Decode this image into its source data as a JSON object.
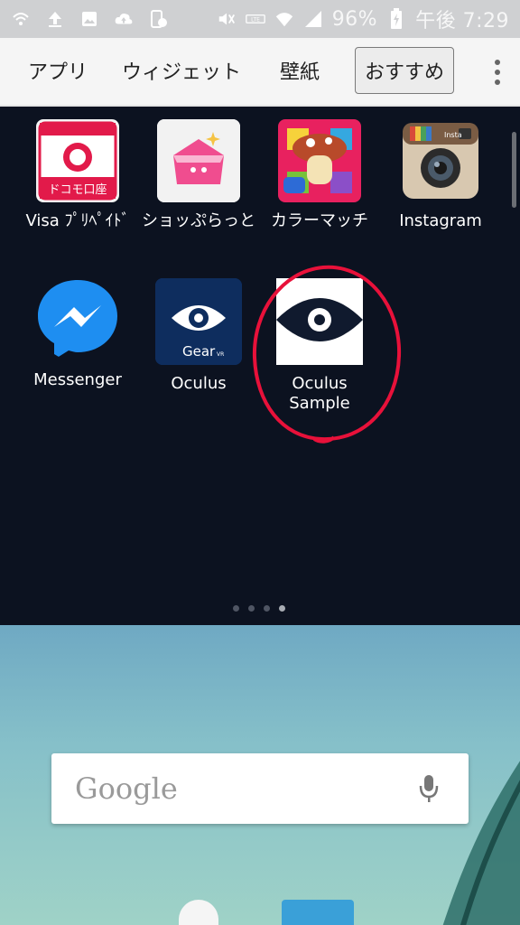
{
  "status_bar": {
    "battery_percent": "96%",
    "time": "午後 7:29",
    "left_icons": [
      "wifi-calling-icon",
      "upload-icon",
      "image-icon",
      "cloud-upload-icon",
      "device-sync-icon"
    ],
    "right_icons": [
      "mute-icon",
      "volte-icon",
      "wifi-icon",
      "signal-icon",
      "battery-charging-icon"
    ]
  },
  "tabs": {
    "apps": "アプリ",
    "widgets": "ウィジェット",
    "wallpaper": "壁紙",
    "recommend": "おすすめ"
  },
  "apps": [
    {
      "label": "Visa ﾌﾟﾘﾍﾟｲﾄﾞ",
      "icon": "docomo-koza-icon"
    },
    {
      "label": "ショッぷらっと",
      "icon": "shop-plat-icon"
    },
    {
      "label": "カラーマッチ",
      "icon": "color-match-icon"
    },
    {
      "label": "Instagram",
      "icon": "instagram-icon"
    },
    {
      "label": "Messenger",
      "icon": "messenger-icon"
    },
    {
      "label": "Oculus",
      "icon": "oculus-gear-vr-icon"
    },
    {
      "label": "Oculus Sample",
      "icon": "oculus-sample-icon"
    }
  ],
  "icon_text": {
    "docomo": "ドコモ口座",
    "gear": "Gear",
    "vr": "VR",
    "insta": "Insta"
  },
  "home": {
    "google_label": "Google"
  },
  "colors": {
    "accent": "#e0214a",
    "drawer_bg": "#0c1220",
    "annotation": "#e8113a"
  }
}
